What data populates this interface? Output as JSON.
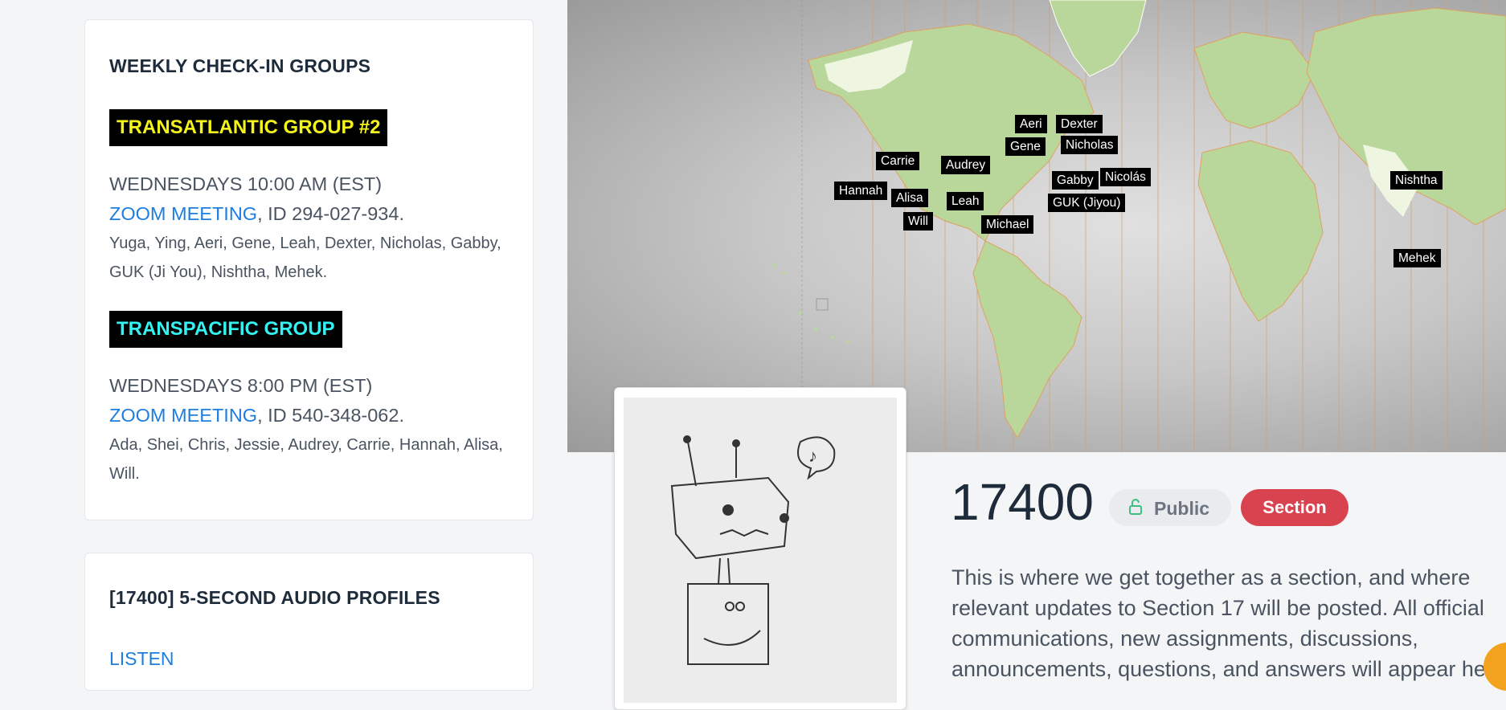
{
  "checkin": {
    "title": "WEEKLY CHECK-IN GROUPS",
    "groups": [
      {
        "name": "TRANSATLANTIC GROUP #2",
        "time": "WEDNESDAYS 10:00 AM (EST)",
        "link_label": "ZOOM MEETING",
        "meeting_id": ", ID 294-027-934.",
        "members": "Yuga, Ying, Aeri, Gene, Leah, Dexter, Nicholas, Gabby, GUK (Ji You), Nishtha, Mehek."
      },
      {
        "name": "TRANSPACIFIC GROUP",
        "time": "WEDNESDAYS 8:00 PM (EST)",
        "link_label": "ZOOM MEETING",
        "meeting_id": ", ID 540-348-062.",
        "members": "Ada, Shei, Chris, Jessie, Audrey, Carrie, Hannah, Alisa, Will."
      }
    ]
  },
  "audio": {
    "title": "[17400] 5-SECOND AUDIO PROFILES",
    "listen_label": "LISTEN"
  },
  "map": {
    "labels": [
      "Aeri",
      "Dexter",
      "Gene",
      "Nicholas",
      "Carrie",
      "Audrey",
      "Gabby",
      "Nicolás",
      "Hannah",
      "Alisa",
      "Leah",
      "GUK (Jiyou)",
      "Will",
      "Michael",
      "Nishtha",
      "Mehek"
    ]
  },
  "course": {
    "number": "17400",
    "visibility": "Public",
    "type": "Section",
    "description": "This is where we get together as a section, and where relevant updates to Section 17 will be posted. All official communications, new assignments, discussions, announcements, questions, and answers will appear here."
  },
  "colors": {
    "link": "#1d7ee0",
    "section_badge": "#d9434f",
    "yellow_tag": "#f4f41c",
    "cyan_tag": "#33f2f2"
  }
}
